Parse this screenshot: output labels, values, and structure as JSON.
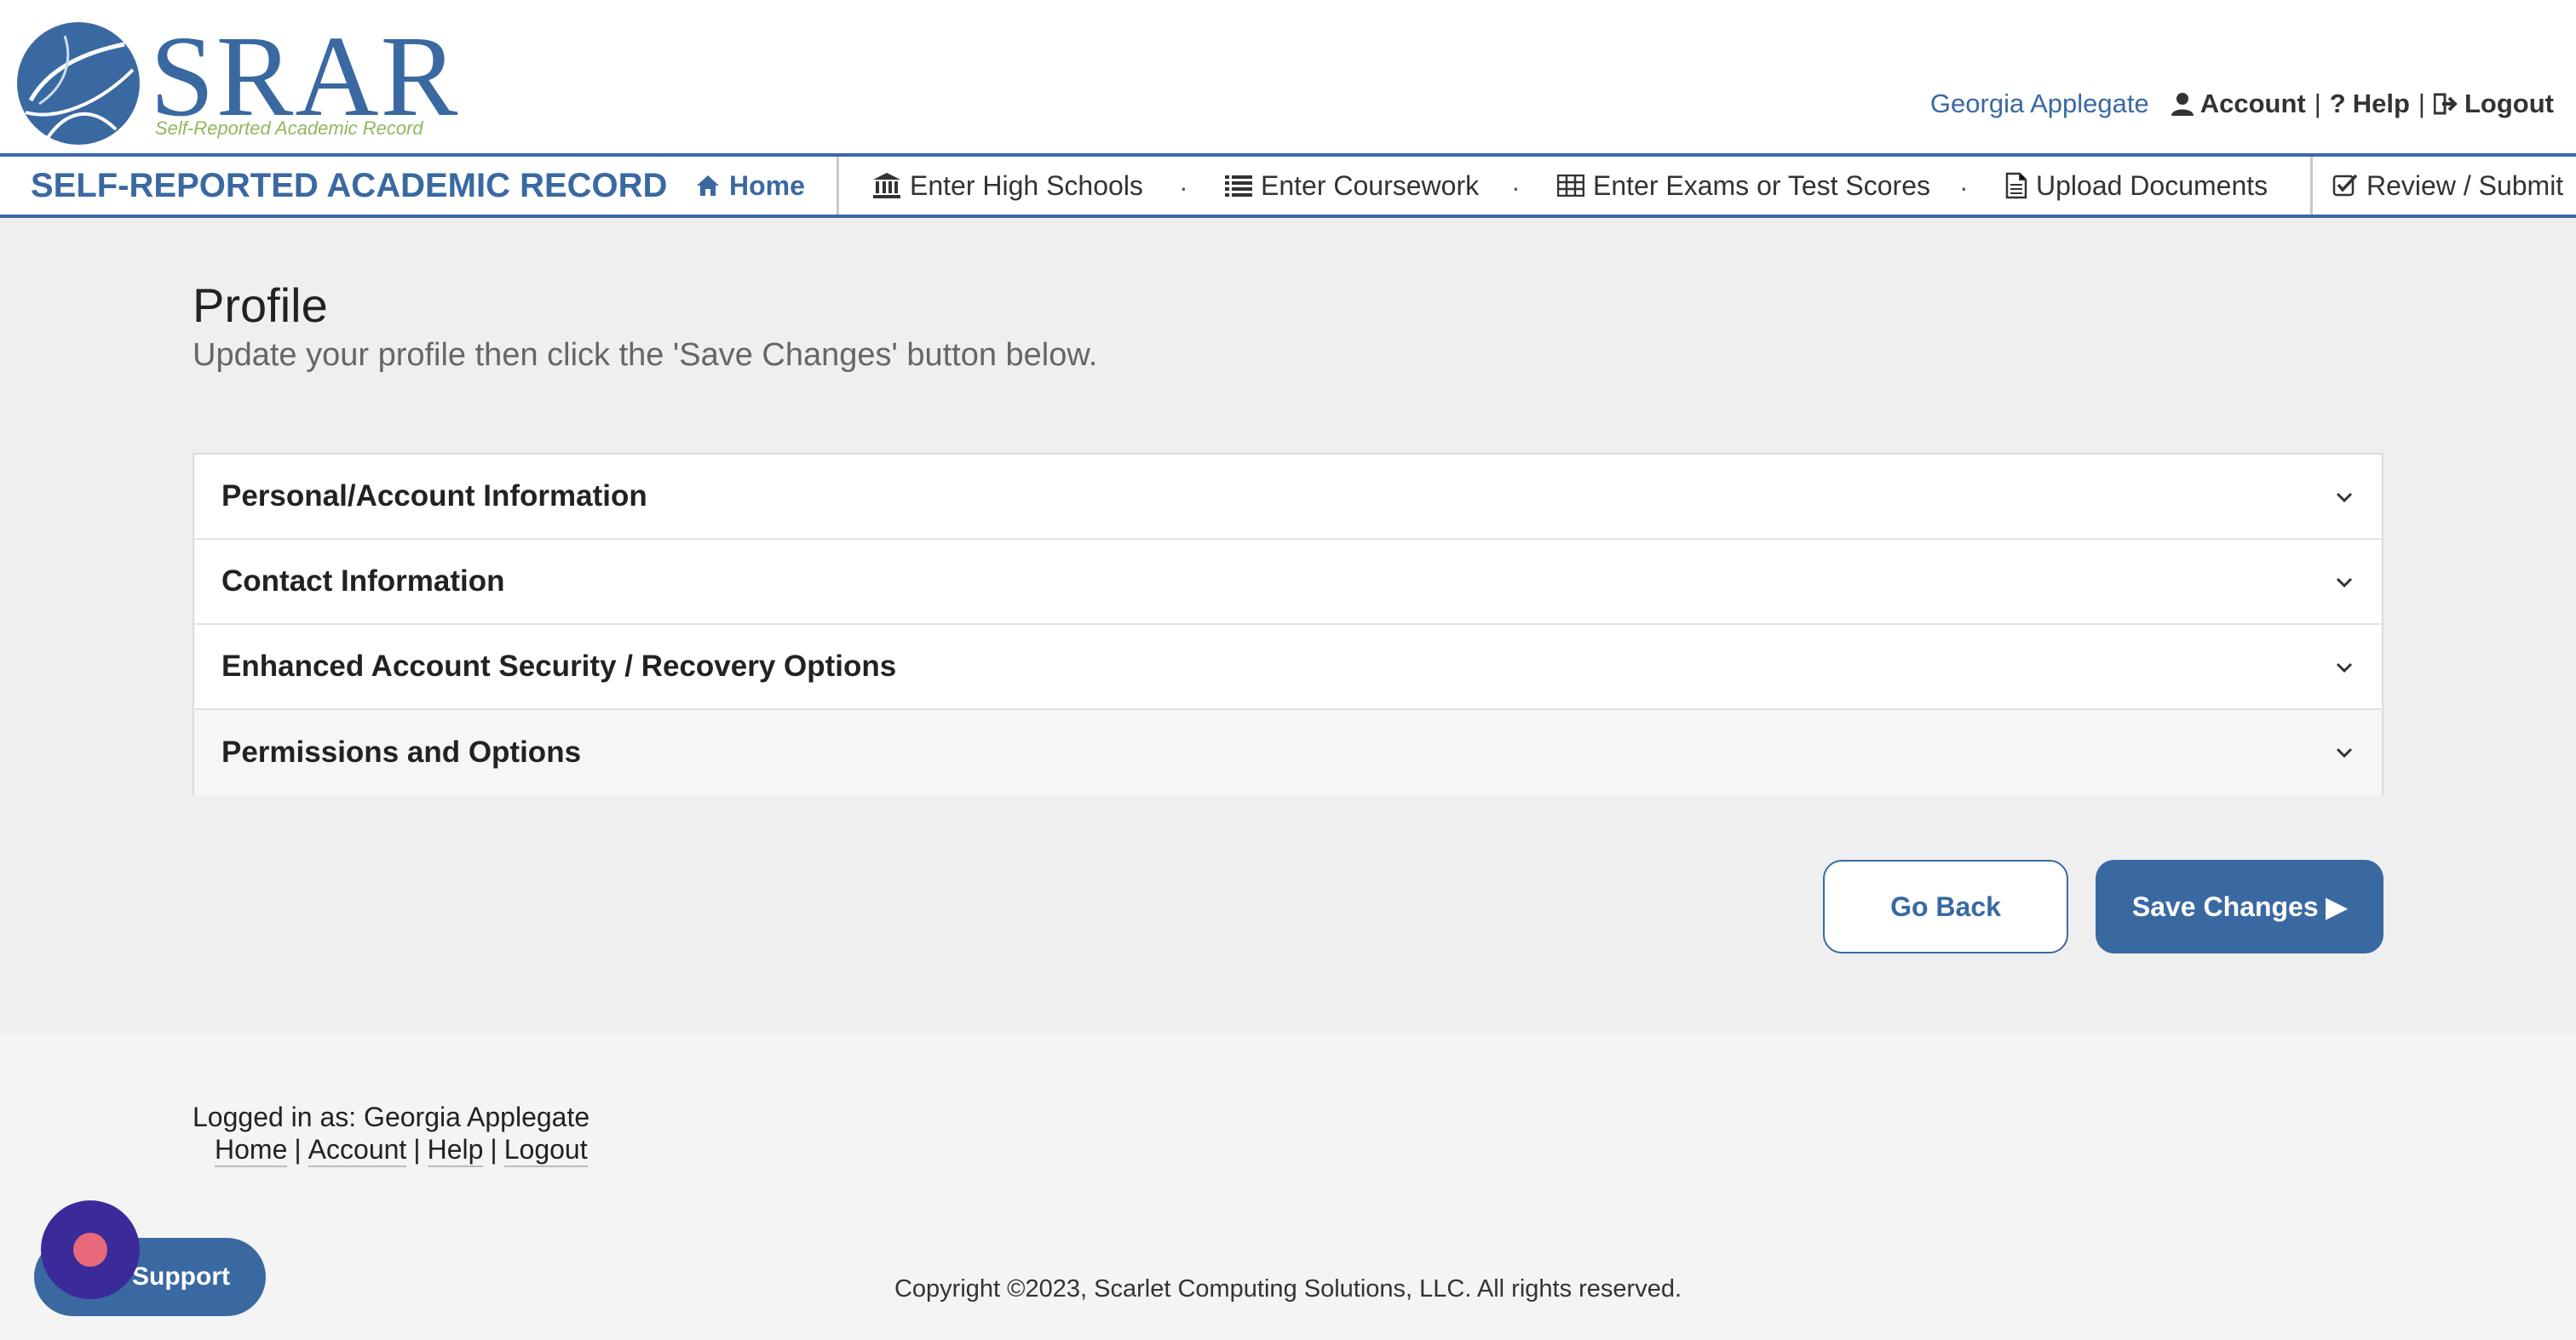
{
  "header": {
    "logo_text": "SRAR",
    "logo_subtitle": "Self-Reported Academic Record",
    "user_name": "Georgia Applegate",
    "account_label": "Account",
    "help_label": "Help",
    "logout_label": "Logout",
    "separator": "|"
  },
  "nav": {
    "brand": "SELF-REPORTED ACADEMIC RECORD",
    "home": "Home",
    "items": [
      {
        "label": "Enter High Schools",
        "icon": "bank-icon"
      },
      {
        "label": "Enter Coursework",
        "icon": "list-icon"
      },
      {
        "label": "Enter Exams or Test Scores",
        "icon": "table-icon"
      },
      {
        "label": "Upload Documents",
        "icon": "document-icon"
      },
      {
        "label": "Review / Submit",
        "icon": "check-square-icon"
      }
    ],
    "dot": "·"
  },
  "main": {
    "title": "Profile",
    "subtitle": "Update your profile then click the 'Save Changes' button below.",
    "sections": [
      {
        "label": "Personal/Account Information"
      },
      {
        "label": "Contact Information"
      },
      {
        "label": "Enhanced Account Security / Recovery Options"
      },
      {
        "label": "Permissions and Options"
      }
    ],
    "go_back_label": "Go Back",
    "save_label": "Save Changes ▶"
  },
  "footer": {
    "logged_in_as": "Logged in as: Georgia Applegate",
    "links": [
      "Home",
      "Account",
      "Help",
      "Logout"
    ],
    "copyright": "Copyright ©2023, Scarlet Computing Solutions, LLC. All rights reserved.",
    "support_label": "Support"
  },
  "colors": {
    "brand": "#3a69a2",
    "accent_green": "#8fb85c",
    "support_circle": "#3b2a9a"
  }
}
